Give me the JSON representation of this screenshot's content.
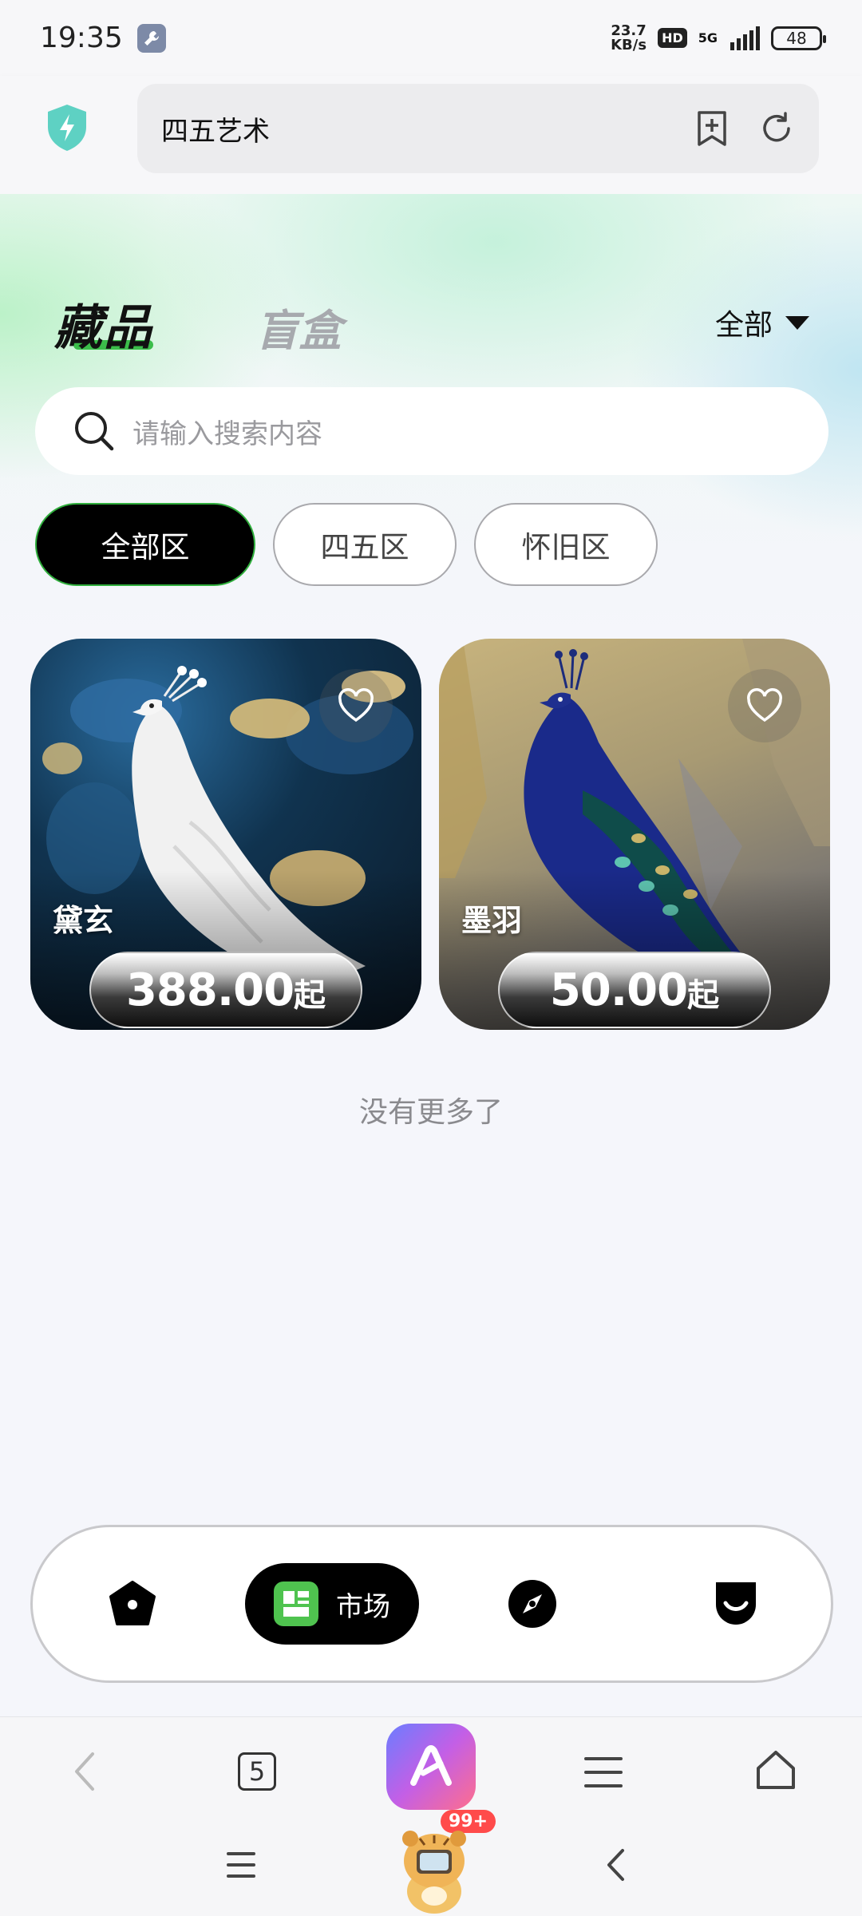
{
  "status_bar": {
    "time": "19:35",
    "net_speed_value": "23.7",
    "net_speed_unit": "KB/s",
    "hd": "HD",
    "network": "5G",
    "battery": "48"
  },
  "browser": {
    "url_title": "四五艺术",
    "tabs_count": "5",
    "notification_badge": "99+"
  },
  "page": {
    "tabs": [
      {
        "label": "藏品",
        "active": true
      },
      {
        "label": "盲盒",
        "active": false
      }
    ],
    "filter_label": "全部",
    "search_placeholder": "请输入搜索内容",
    "zones": [
      {
        "label": "全部区",
        "active": true
      },
      {
        "label": "四五区",
        "active": false
      },
      {
        "label": "怀旧区",
        "active": false
      }
    ],
    "items": [
      {
        "title": "黛玄",
        "price": "388.00",
        "price_suffix": "起",
        "artwork": "white-peacock-painting"
      },
      {
        "title": "墨羽",
        "price": "50.00",
        "price_suffix": "起",
        "artwork": "blue-peacock-painting"
      }
    ],
    "end_text": "没有更多了"
  },
  "app_nav": {
    "items": [
      {
        "icon": "home-icon",
        "label": ""
      },
      {
        "icon": "market-icon",
        "label": "市场",
        "active": true
      },
      {
        "icon": "compass-icon",
        "label": ""
      },
      {
        "icon": "profile-smile-icon",
        "label": ""
      }
    ]
  },
  "colors": {
    "accent_green": "#3bbd4a",
    "active_chip_bg": "#000000",
    "page_bg": "#f5f6fb"
  }
}
